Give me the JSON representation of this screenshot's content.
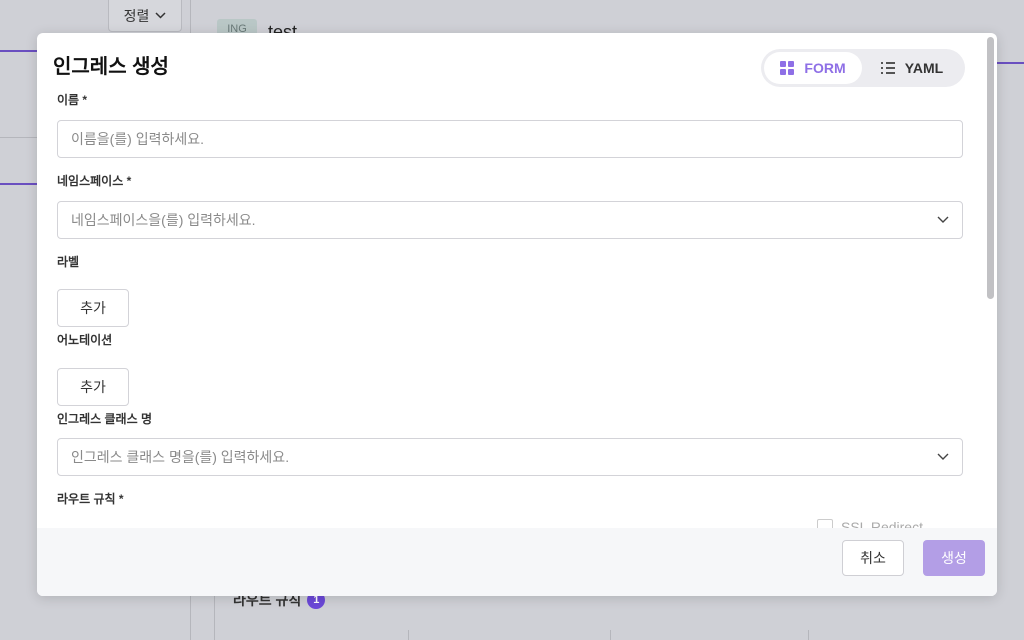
{
  "background": {
    "sort_label": "정렬",
    "ing_badge": "ING",
    "item_name": "test",
    "rules_label": "라우트 규칙",
    "rules_count": "1"
  },
  "modal": {
    "title": "인그레스 생성",
    "mode_form": "FORM",
    "mode_yaml": "YAML",
    "accent_color": "#8e6fe6",
    "fields": {
      "name_label": "이름 *",
      "name_placeholder": "이름을(를) 입력하세요.",
      "namespace_label": "네임스페이스 *",
      "namespace_placeholder": "네임스페이스을(를) 입력하세요.",
      "labels_label": "라벨",
      "labels_add": "추가",
      "annotations_label": "어노테이션",
      "annotations_add": "추가",
      "ingress_class_label": "인그레스 클래스 명",
      "ingress_class_placeholder": "인그레스 클래스 명을(를) 입력하세요.",
      "route_rules_label": "라우트 규칙 *",
      "ssl_redirect": "SSL Redirect"
    },
    "footer": {
      "cancel": "취소",
      "create": "생성"
    }
  }
}
